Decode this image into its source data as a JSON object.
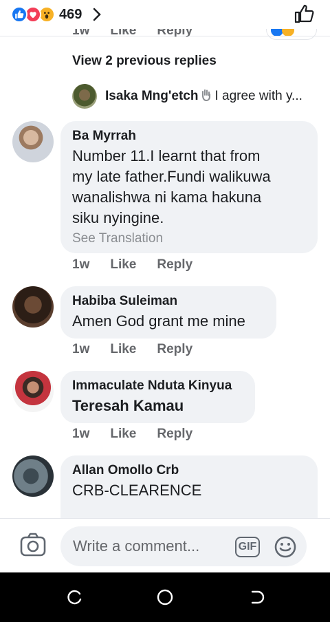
{
  "header": {
    "reaction_count": "469",
    "reactions": [
      "like-icon",
      "love-icon",
      "wow-icon"
    ]
  },
  "previous_comment": {
    "time": "1w",
    "like": "Like",
    "reply": "Reply"
  },
  "view_replies": "View 2 previous replies",
  "reply_preview": {
    "name": "Isaka Mng'etch",
    "text": "I agree with y..."
  },
  "comments": [
    {
      "name": "Ba Myrrah",
      "lines": [
        "Number 11.I learnt that from",
        "my late father.Fundi walikuwa",
        "wanalishwa ni kama hakuna",
        "siku nyingine."
      ],
      "see_translation": "See Translation",
      "time": "1w",
      "like": "Like",
      "reply": "Reply"
    },
    {
      "name": "Habiba Suleiman",
      "text": "Amen God grant me mine",
      "time": "1w",
      "like": "Like",
      "reply": "Reply"
    },
    {
      "name": "Immaculate Nduta Kinyua",
      "text": "Teresah Kamau",
      "time": "1w",
      "like": "Like",
      "reply": "Reply"
    },
    {
      "name": "Allan Omollo Crb",
      "text": "CRB-CLEARENCE"
    }
  ],
  "composer": {
    "placeholder": "Write a comment...",
    "gif_label": "GIF"
  },
  "colors": {
    "accent": "#1877f2",
    "bubble": "#f0f2f5",
    "muted": "#65676b"
  }
}
